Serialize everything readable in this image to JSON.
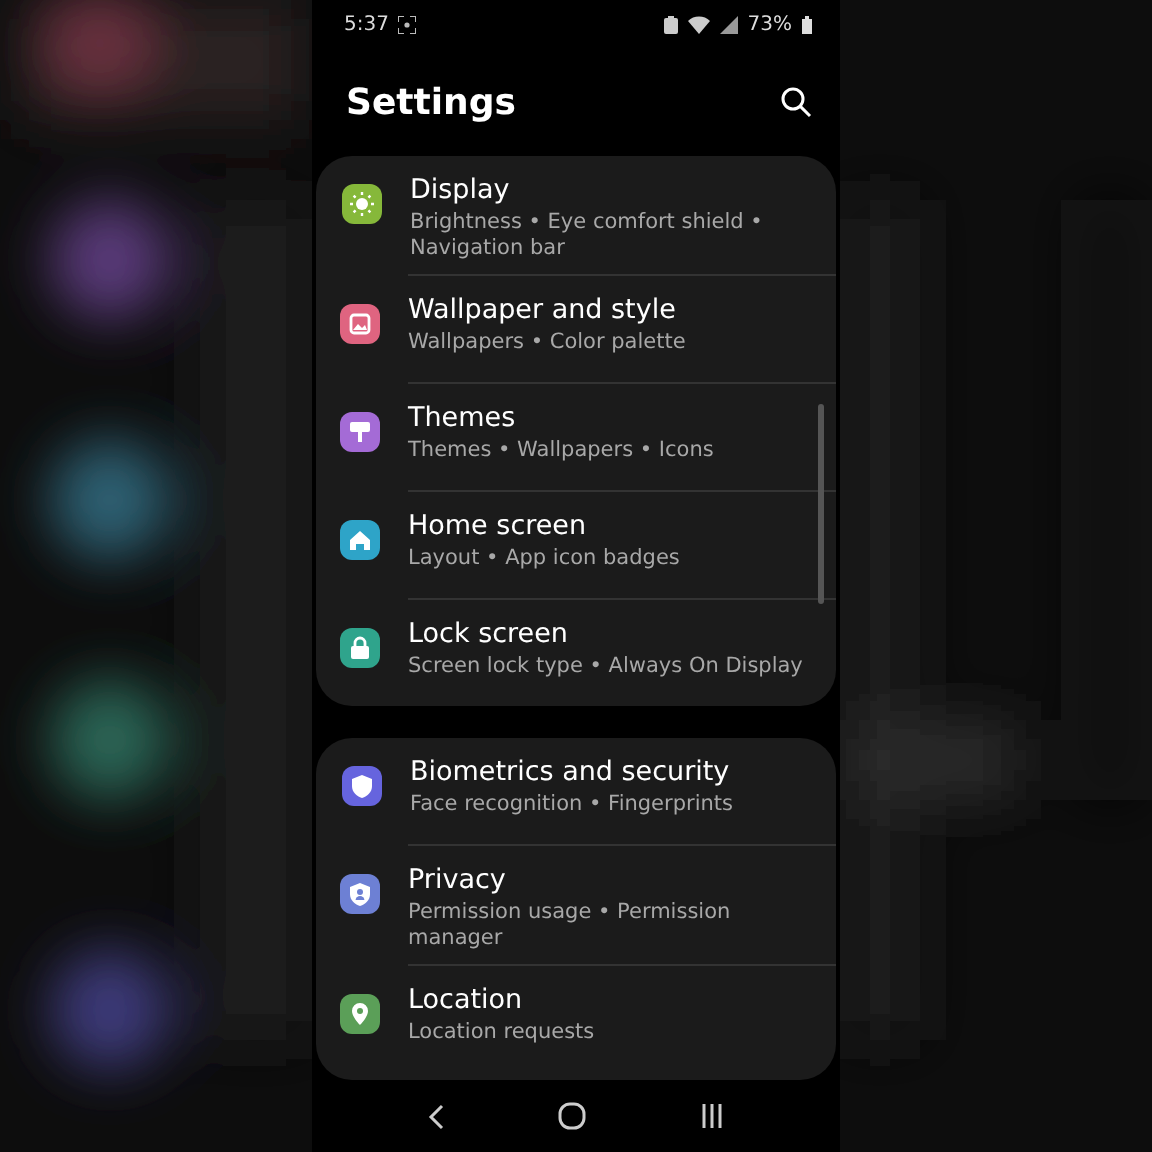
{
  "status_bar": {
    "time": "5:37",
    "battery": "73%"
  },
  "header": {
    "title": "Settings"
  },
  "groups": [
    {
      "rows": [
        {
          "kind": "display",
          "title": "Display",
          "subtitle": "Brightness • Eye comfort shield • Navigation bar",
          "color": "#86b83a"
        },
        {
          "kind": "wallpaper",
          "title": "Wallpaper and style",
          "subtitle": "Wallpapers • Color palette",
          "color": "#df6480"
        },
        {
          "kind": "themes",
          "title": "Themes",
          "subtitle": "Themes • Wallpapers • Icons",
          "color": "#a46bd6"
        },
        {
          "kind": "home",
          "title": "Home screen",
          "subtitle": "Layout • App icon badges",
          "color": "#2ea4c8"
        },
        {
          "kind": "lock",
          "title": "Lock screen",
          "subtitle": "Screen lock type • Always On Display",
          "color": "#2fa48c"
        }
      ]
    },
    {
      "rows": [
        {
          "kind": "biometrics",
          "title": "Biometrics and security",
          "subtitle": "Face recognition • Fingerprints",
          "color": "#6664de"
        },
        {
          "kind": "privacy",
          "title": "Privacy",
          "subtitle": "Permission usage • Permission manager",
          "color": "#6d80d4"
        },
        {
          "kind": "location",
          "title": "Location",
          "subtitle": "Location requests",
          "color": "#5b9f58"
        }
      ]
    }
  ]
}
